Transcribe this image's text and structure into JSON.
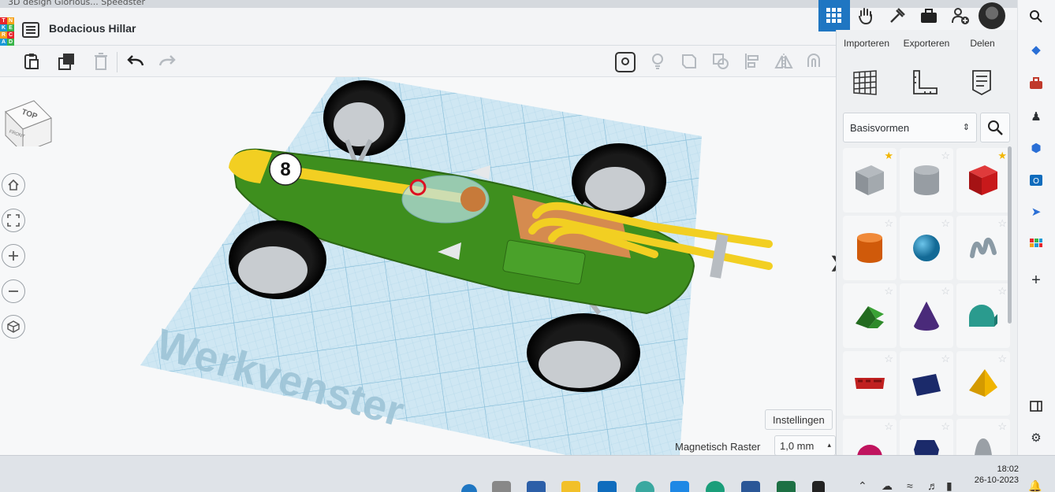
{
  "browser": {
    "tab_title": "3D design Glorious... Speedster"
  },
  "app": {
    "design_name": "Bodacious Hillar",
    "logo_letters": [
      "T",
      "N",
      "K",
      "E",
      "R",
      "C",
      "A",
      "D"
    ]
  },
  "header_actions": {
    "import_label": "Importeren",
    "export_label": "Exporteren",
    "share_label": "Delen"
  },
  "shapes_panel": {
    "category_value": "Basisvormen",
    "shapes": [
      {
        "name": "box-striped",
        "color": "#9aa0a6",
        "starred": true
      },
      {
        "name": "cylinder-striped",
        "color": "#9aa0a6",
        "starred": false
      },
      {
        "name": "box",
        "color": "#c8191b",
        "starred": true
      },
      {
        "name": "cylinder",
        "color": "#e06a12",
        "starred": false
      },
      {
        "name": "sphere",
        "color": "#1f8bbf",
        "starred": false
      },
      {
        "name": "scribble",
        "color": "#8a9aa5",
        "starred": false
      },
      {
        "name": "roof",
        "color": "#2f8a2b",
        "starred": false
      },
      {
        "name": "cone",
        "color": "#4a2a7a",
        "starred": false
      },
      {
        "name": "round-roof",
        "color": "#2a9b8e",
        "starred": false
      },
      {
        "name": "text",
        "color": "#c02020",
        "starred": false
      },
      {
        "name": "prism",
        "color": "#1b2a6a",
        "starred": false
      },
      {
        "name": "pyramid",
        "color": "#f0b400",
        "starred": false
      },
      {
        "name": "half-sphere",
        "color": "#c0145e",
        "starred": false
      },
      {
        "name": "polygon",
        "color": "#1b2a6a",
        "starred": false
      },
      {
        "name": "paraboloid",
        "color": "#9aa0a6",
        "starred": false
      }
    ]
  },
  "workplane": {
    "label": "Werkvenster",
    "view_cube_top": "TOP",
    "view_cube_front": "FRONT",
    "car_number": "8",
    "settings_label": "Instellingen",
    "snap_label": "Magnetisch Raster",
    "snap_value": "1,0 mm"
  },
  "taskbar": {
    "time": "18:02",
    "date": "26-10-2023"
  }
}
